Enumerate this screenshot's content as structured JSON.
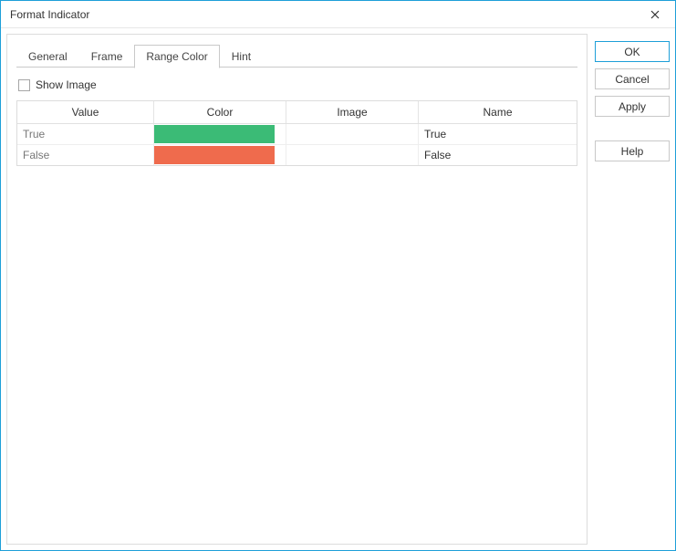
{
  "window": {
    "title": "Format Indicator"
  },
  "tabs": {
    "general": "General",
    "frame": "Frame",
    "range_color": "Range Color",
    "hint": "Hint",
    "active": "range_color"
  },
  "checkbox": {
    "show_image_label": "Show Image",
    "show_image_checked": false
  },
  "table": {
    "headers": {
      "value": "Value",
      "color": "Color",
      "image": "Image",
      "name": "Name"
    },
    "rows": [
      {
        "value": "True",
        "color": "#3bbb76",
        "image": "",
        "name": "True"
      },
      {
        "value": "False",
        "color": "#ef6b4d",
        "image": "",
        "name": "False"
      }
    ]
  },
  "buttons": {
    "ok": "OK",
    "cancel": "Cancel",
    "apply": "Apply",
    "help": "Help"
  }
}
